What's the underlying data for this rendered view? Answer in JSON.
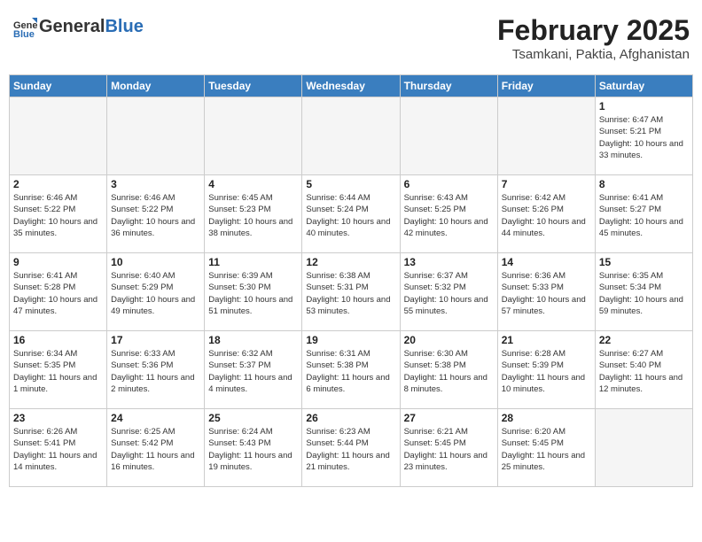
{
  "header": {
    "logo_general": "General",
    "logo_blue": "Blue",
    "month_year": "February 2025",
    "location": "Tsamkani, Paktia, Afghanistan"
  },
  "days_of_week": [
    "Sunday",
    "Monday",
    "Tuesday",
    "Wednesday",
    "Thursday",
    "Friday",
    "Saturday"
  ],
  "weeks": [
    [
      {
        "day": "",
        "info": ""
      },
      {
        "day": "",
        "info": ""
      },
      {
        "day": "",
        "info": ""
      },
      {
        "day": "",
        "info": ""
      },
      {
        "day": "",
        "info": ""
      },
      {
        "day": "",
        "info": ""
      },
      {
        "day": "1",
        "info": "Sunrise: 6:47 AM\nSunset: 5:21 PM\nDaylight: 10 hours and 33 minutes."
      }
    ],
    [
      {
        "day": "2",
        "info": "Sunrise: 6:46 AM\nSunset: 5:22 PM\nDaylight: 10 hours and 35 minutes."
      },
      {
        "day": "3",
        "info": "Sunrise: 6:46 AM\nSunset: 5:22 PM\nDaylight: 10 hours and 36 minutes."
      },
      {
        "day": "4",
        "info": "Sunrise: 6:45 AM\nSunset: 5:23 PM\nDaylight: 10 hours and 38 minutes."
      },
      {
        "day": "5",
        "info": "Sunrise: 6:44 AM\nSunset: 5:24 PM\nDaylight: 10 hours and 40 minutes."
      },
      {
        "day": "6",
        "info": "Sunrise: 6:43 AM\nSunset: 5:25 PM\nDaylight: 10 hours and 42 minutes."
      },
      {
        "day": "7",
        "info": "Sunrise: 6:42 AM\nSunset: 5:26 PM\nDaylight: 10 hours and 44 minutes."
      },
      {
        "day": "8",
        "info": "Sunrise: 6:41 AM\nSunset: 5:27 PM\nDaylight: 10 hours and 45 minutes."
      }
    ],
    [
      {
        "day": "9",
        "info": "Sunrise: 6:41 AM\nSunset: 5:28 PM\nDaylight: 10 hours and 47 minutes."
      },
      {
        "day": "10",
        "info": "Sunrise: 6:40 AM\nSunset: 5:29 PM\nDaylight: 10 hours and 49 minutes."
      },
      {
        "day": "11",
        "info": "Sunrise: 6:39 AM\nSunset: 5:30 PM\nDaylight: 10 hours and 51 minutes."
      },
      {
        "day": "12",
        "info": "Sunrise: 6:38 AM\nSunset: 5:31 PM\nDaylight: 10 hours and 53 minutes."
      },
      {
        "day": "13",
        "info": "Sunrise: 6:37 AM\nSunset: 5:32 PM\nDaylight: 10 hours and 55 minutes."
      },
      {
        "day": "14",
        "info": "Sunrise: 6:36 AM\nSunset: 5:33 PM\nDaylight: 10 hours and 57 minutes."
      },
      {
        "day": "15",
        "info": "Sunrise: 6:35 AM\nSunset: 5:34 PM\nDaylight: 10 hours and 59 minutes."
      }
    ],
    [
      {
        "day": "16",
        "info": "Sunrise: 6:34 AM\nSunset: 5:35 PM\nDaylight: 11 hours and 1 minute."
      },
      {
        "day": "17",
        "info": "Sunrise: 6:33 AM\nSunset: 5:36 PM\nDaylight: 11 hours and 2 minutes."
      },
      {
        "day": "18",
        "info": "Sunrise: 6:32 AM\nSunset: 5:37 PM\nDaylight: 11 hours and 4 minutes."
      },
      {
        "day": "19",
        "info": "Sunrise: 6:31 AM\nSunset: 5:38 PM\nDaylight: 11 hours and 6 minutes."
      },
      {
        "day": "20",
        "info": "Sunrise: 6:30 AM\nSunset: 5:38 PM\nDaylight: 11 hours and 8 minutes."
      },
      {
        "day": "21",
        "info": "Sunrise: 6:28 AM\nSunset: 5:39 PM\nDaylight: 11 hours and 10 minutes."
      },
      {
        "day": "22",
        "info": "Sunrise: 6:27 AM\nSunset: 5:40 PM\nDaylight: 11 hours and 12 minutes."
      }
    ],
    [
      {
        "day": "23",
        "info": "Sunrise: 6:26 AM\nSunset: 5:41 PM\nDaylight: 11 hours and 14 minutes."
      },
      {
        "day": "24",
        "info": "Sunrise: 6:25 AM\nSunset: 5:42 PM\nDaylight: 11 hours and 16 minutes."
      },
      {
        "day": "25",
        "info": "Sunrise: 6:24 AM\nSunset: 5:43 PM\nDaylight: 11 hours and 19 minutes."
      },
      {
        "day": "26",
        "info": "Sunrise: 6:23 AM\nSunset: 5:44 PM\nDaylight: 11 hours and 21 minutes."
      },
      {
        "day": "27",
        "info": "Sunrise: 6:21 AM\nSunset: 5:45 PM\nDaylight: 11 hours and 23 minutes."
      },
      {
        "day": "28",
        "info": "Sunrise: 6:20 AM\nSunset: 5:45 PM\nDaylight: 11 hours and 25 minutes."
      },
      {
        "day": "",
        "info": ""
      }
    ]
  ]
}
